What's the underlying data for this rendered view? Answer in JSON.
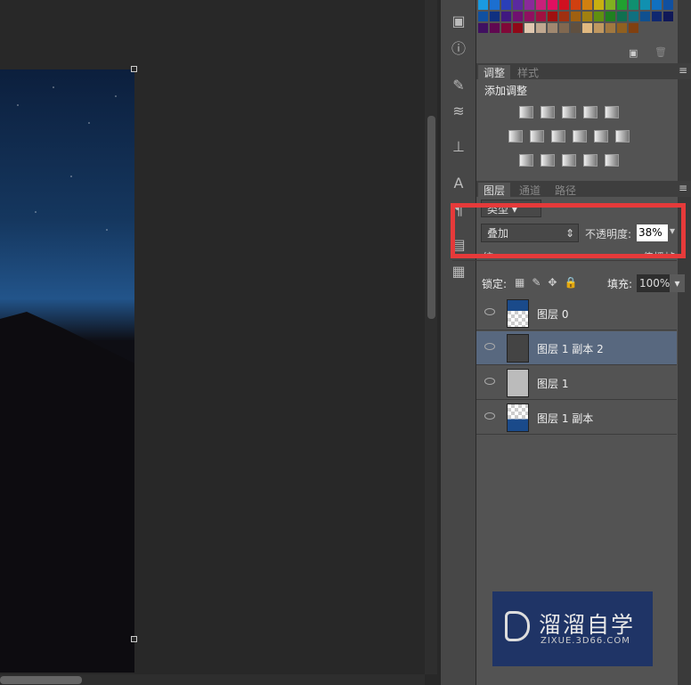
{
  "adjust_panel": {
    "tabs": [
      "调整",
      "样式"
    ],
    "title": "添加调整"
  },
  "layers_panel": {
    "tabs": [
      "图层",
      "通道",
      "路径"
    ],
    "filter_kind": "类型",
    "blend_mode": "叠加",
    "opacity_label": "不透明度:",
    "opacity_value": "38%",
    "unify_label": "统一:",
    "propagate_label": "传播帧",
    "lock_label": "锁定:",
    "fill_label": "填充:",
    "fill_value": "100%",
    "layers": [
      {
        "name": "图层 0",
        "selected": false
      },
      {
        "name": "图层 1 副本 2",
        "selected": true
      },
      {
        "name": "图层 1",
        "selected": false
      },
      {
        "name": "图层 1 副本",
        "selected": false
      }
    ]
  },
  "watermark": {
    "brand": "溜溜自学",
    "url": "ZIXUE.3D66.COM"
  },
  "colors": {
    "highlight": "#e63a3a",
    "selected_layer": "#58687f",
    "panel": "#535353"
  }
}
